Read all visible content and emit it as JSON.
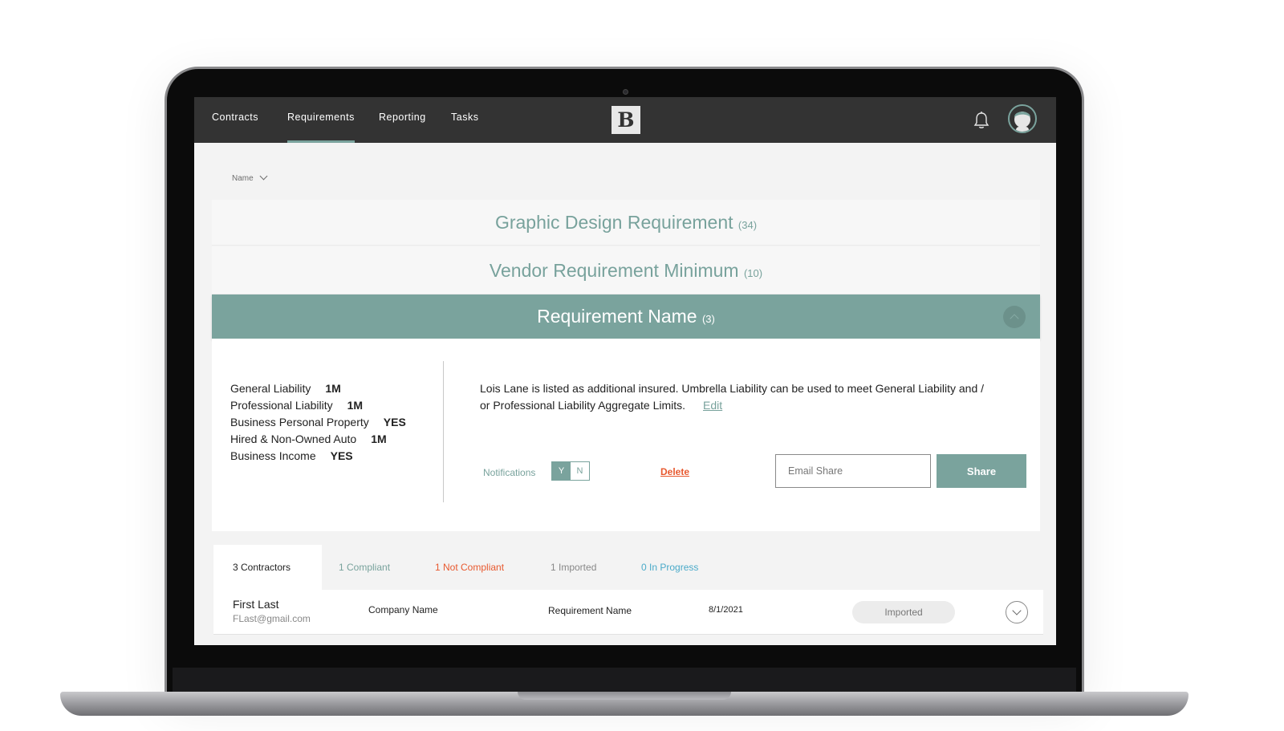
{
  "nav": {
    "items": [
      {
        "label": "Contracts"
      },
      {
        "label": "Requirements"
      },
      {
        "label": "Reporting"
      },
      {
        "label": "Tasks"
      }
    ],
    "active": "Requirements",
    "logo_text": "B"
  },
  "icons": {
    "bell": "bell-icon",
    "avatar": "avatar",
    "sort_chevron": "chevron-down-icon",
    "collapse": "chevron-up-icon",
    "expand": "chevron-down-icon"
  },
  "sort": {
    "label": "Name"
  },
  "requirements": [
    {
      "name": "Graphic Design Requirement",
      "count": "(34)"
    },
    {
      "name": "Vendor Requirement Minimum",
      "count": "(10)"
    },
    {
      "name": "Requirement Name",
      "count": "(3)"
    }
  ],
  "coverages": [
    {
      "label": "General Liability",
      "value": "1M"
    },
    {
      "label": "Professional Liability",
      "value": "1M"
    },
    {
      "label": "Business Personal Property",
      "value": "YES"
    },
    {
      "label": "Hired & Non-Owned Auto",
      "value": "1M"
    },
    {
      "label": "Business Income",
      "value": "YES"
    }
  ],
  "description": "Lois Lane is listed as additional insured. Umbrella Liability can be used to meet General Liability and / or Professional Liability Aggregate Limits.",
  "edit_label": "Edit",
  "notifications": {
    "label": "Notifications",
    "yes": "Y",
    "no": "N",
    "selected": "Y"
  },
  "delete_label": "Delete",
  "email_share": {
    "placeholder": "Email Share"
  },
  "share_label": "Share",
  "tabs": [
    {
      "label": "3 Contractors",
      "color": "#222222"
    },
    {
      "label": "1 Compliant",
      "color": "#78a29c"
    },
    {
      "label": "1 Not Compliant",
      "color": "#e8592f"
    },
    {
      "label": "1 Imported",
      "color": "#888888"
    },
    {
      "label": "0 In Progress",
      "color": "#4aaac9"
    }
  ],
  "contractor_rows": [
    {
      "name": "First Last",
      "email": "FLast@gmail.com",
      "company": "Company Name",
      "requirement": "Requirement Name",
      "date": "8/1/2021",
      "status": "Imported"
    }
  ],
  "colors": {
    "accent": "#7aa39d",
    "topbar": "#333333",
    "danger": "#e8592f",
    "info": "#4aaac9"
  }
}
